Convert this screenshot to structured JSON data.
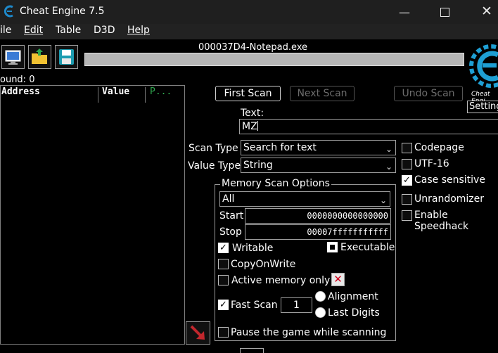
{
  "window": {
    "title": "Cheat Engine 7.5"
  },
  "menu": [
    "ile",
    "Edit",
    "Table",
    "D3D",
    "Help"
  ],
  "process": {
    "name": "000037D4-Notepad.exe"
  },
  "found": "ound: 0",
  "list": {
    "col_address": "Address",
    "col_value": "Value",
    "col_prev": "P..."
  },
  "buttons": {
    "first_scan": "First Scan",
    "next_scan": "Next Scan",
    "undo_scan": "Undo Scan",
    "settings": "Setting"
  },
  "logo_text": "Cheat Engi",
  "text": {
    "label": "Text:",
    "value": "MZ"
  },
  "scan": {
    "scan_type_label": "Scan Type",
    "scan_type": "Search for text",
    "value_type_label": "Value Type",
    "value_type": "String"
  },
  "options": {
    "codepage": "Codepage",
    "utf16": "UTF-16",
    "case_sensitive": "Case sensitive",
    "unrandomizer": "Unrandomizer",
    "speedhack": "Enable Speedhack"
  },
  "memory": {
    "title": "Memory Scan Options",
    "region": "All",
    "start_label": "Start",
    "start": "0000000000000000",
    "stop_label": "Stop",
    "stop": "00007fffffffffff",
    "writable": "Writable",
    "executable": "Executable",
    "copy_on_write": "CopyOnWrite",
    "active_memory_only": "Active memory only",
    "fast_scan": "Fast Scan",
    "fast_scan_value": "1",
    "alignment": "Alignment",
    "last_digits": "Last Digits",
    "pause": "Pause the game while scanning"
  },
  "colors": {
    "prev_col": "#2fa84f",
    "arrow": "#c1272d",
    "folder": "#f1c232",
    "monitor": "#3a7bd5",
    "save": "#1c9cb0"
  }
}
